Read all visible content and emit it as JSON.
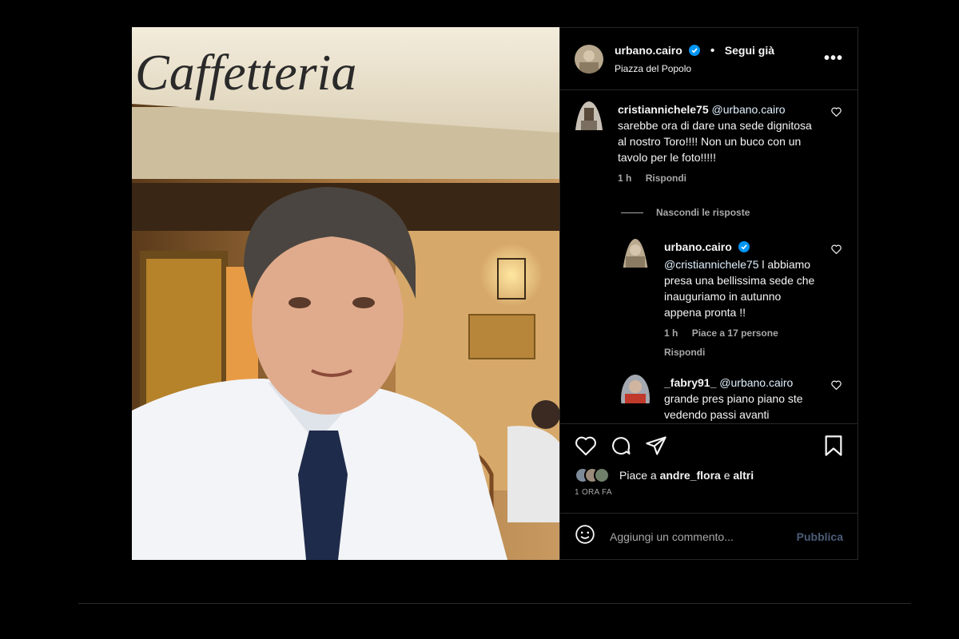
{
  "photo": {
    "sign_text": "Caffetteria"
  },
  "header": {
    "username": "urbano.cairo",
    "separator": "•",
    "follow_label": "Segui già",
    "location": "Piazza del Popolo",
    "more_label": "•••"
  },
  "comments": [
    {
      "username": "cristiannichele75",
      "mention": "@urbano.cairo",
      "text": "sarebbe ora di dare una sede dignitosa al nostro Toro!!!! Non un buco con un tavolo per le foto!!!!!",
      "time": "1 h",
      "reply_label": "Rispondi"
    }
  ],
  "hide_replies_label": "Nascondi le risposte",
  "replies": [
    {
      "username": "urbano.cairo",
      "mention": "@cristiannichele75",
      "text": "l abbiamo presa una bellissima sede che inauguriamo in autunno appena pronta !!",
      "time": "1 h",
      "likes_label": "Piace a 17 persone",
      "reply_label": "Rispondi"
    },
    {
      "username": "_fabry91_",
      "mention": "@urbano.cairo",
      "text": "grande pres piano piano ste vedendo passi avanti"
    }
  ],
  "likes": {
    "prefix": "Piace a ",
    "user": "andre_flora",
    "middle": " e ",
    "others": "altri"
  },
  "timestamp": "1 ORA FA",
  "comment_box": {
    "placeholder": "Aggiungi un commento...",
    "publish_label": "Pubblica"
  },
  "colors": {
    "verified": "#0095f6",
    "publish_disabled": "#4a5d78",
    "border": "#262626"
  }
}
